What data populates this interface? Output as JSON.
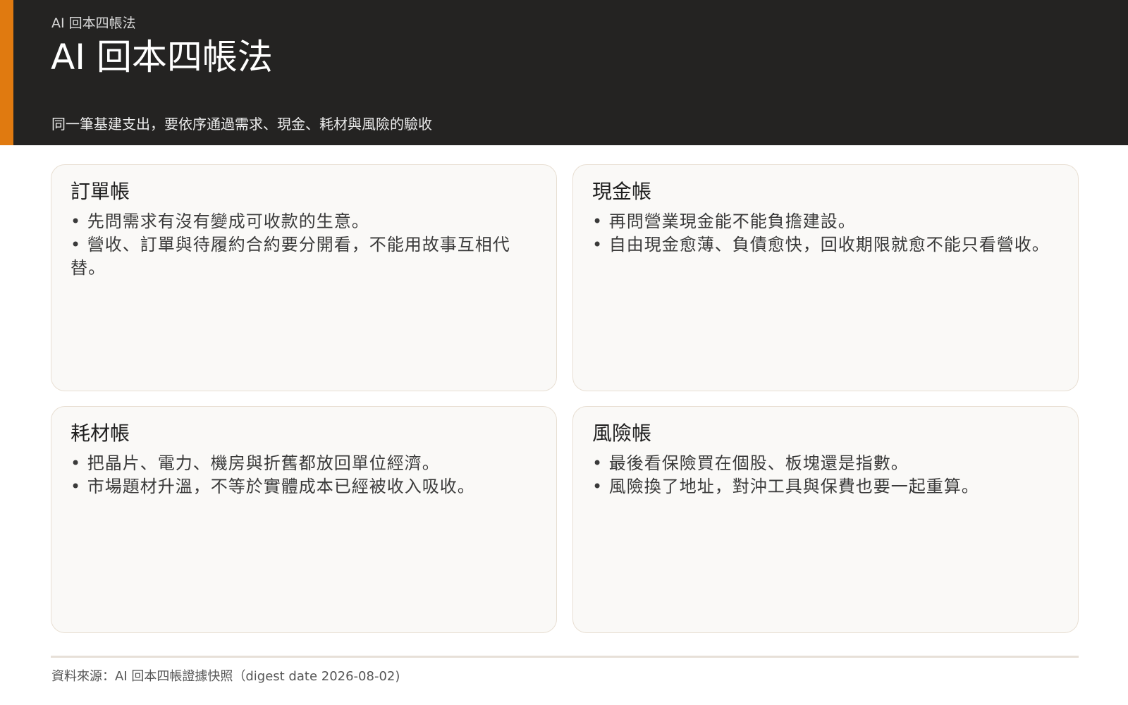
{
  "header": {
    "kicker": "AI 回本四帳法",
    "title": "AI 回本四帳法",
    "subtitle": "同一筆基建支出，要依序通過需求、現金、耗材與風險的驗收",
    "accent_color": "#e07a10",
    "background_color": "#242322"
  },
  "cards": [
    {
      "title": "訂單帳",
      "bullets": [
        "• 先問需求有沒有變成可收款的生意。",
        "• 營收、訂單與待履約合約要分開看，不能用故事互相代替。"
      ]
    },
    {
      "title": "現金帳",
      "bullets": [
        "• 再問營業現金能不能負擔建設。",
        "• 自由現金愈薄、負債愈快，回收期限就愈不能只看營收。"
      ]
    },
    {
      "title": "耗材帳",
      "bullets": [
        "• 把晶片、電力、機房與折舊都放回單位經濟。",
        "• 市場題材升溫，不等於實體成本已經被收入吸收。"
      ]
    },
    {
      "title": "風險帳",
      "bullets": [
        "• 最後看保險買在個股、板塊還是指數。",
        "• 風險換了地址，對沖工具與保費也要一起重算。"
      ]
    }
  ],
  "footer": {
    "source": "資料來源：AI 回本四帳證據快照（digest date 2026-08-02)"
  }
}
